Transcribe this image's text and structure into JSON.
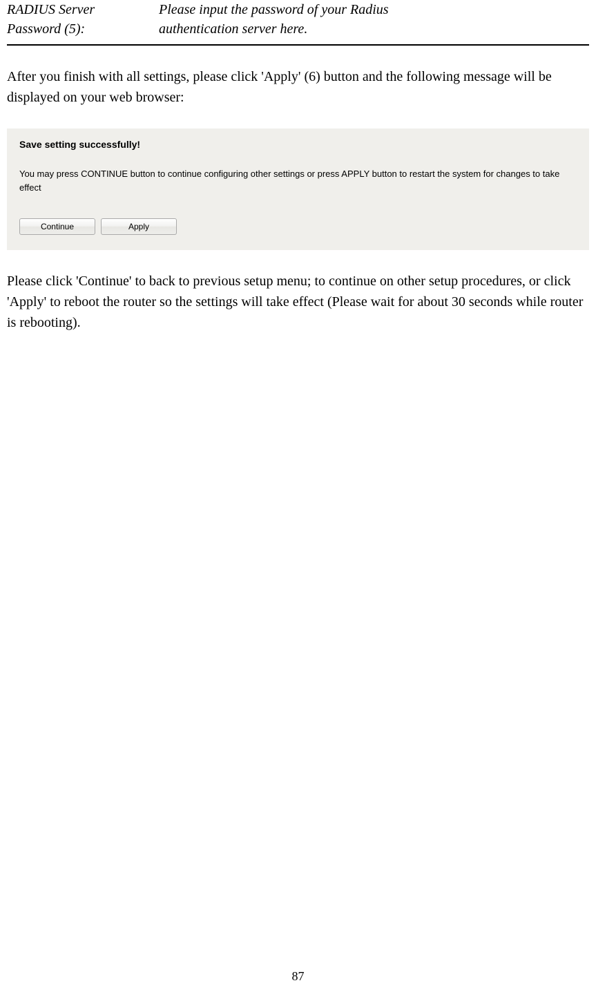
{
  "table": {
    "left_line1": "RADIUS Server",
    "left_line2": "Password (5):",
    "right_line1": "Please input the password of your Radius",
    "right_line2": "authentication server here."
  },
  "para1": "After you finish with all settings, please click 'Apply' (6) button and the following message will be displayed on your web browser:",
  "screenshot": {
    "title": "Save setting successfully!",
    "text": "You may press CONTINUE button to continue configuring other settings or press APPLY button to restart the system for changes to take effect",
    "continue_btn": "Continue",
    "apply_btn": "Apply"
  },
  "para2": "Please click 'Continue' to back to previous setup menu; to continue on other setup procedures, or click 'Apply' to reboot the router so the settings will take effect (Please wait for about 30 seconds while router is rebooting).",
  "page_number": "87"
}
